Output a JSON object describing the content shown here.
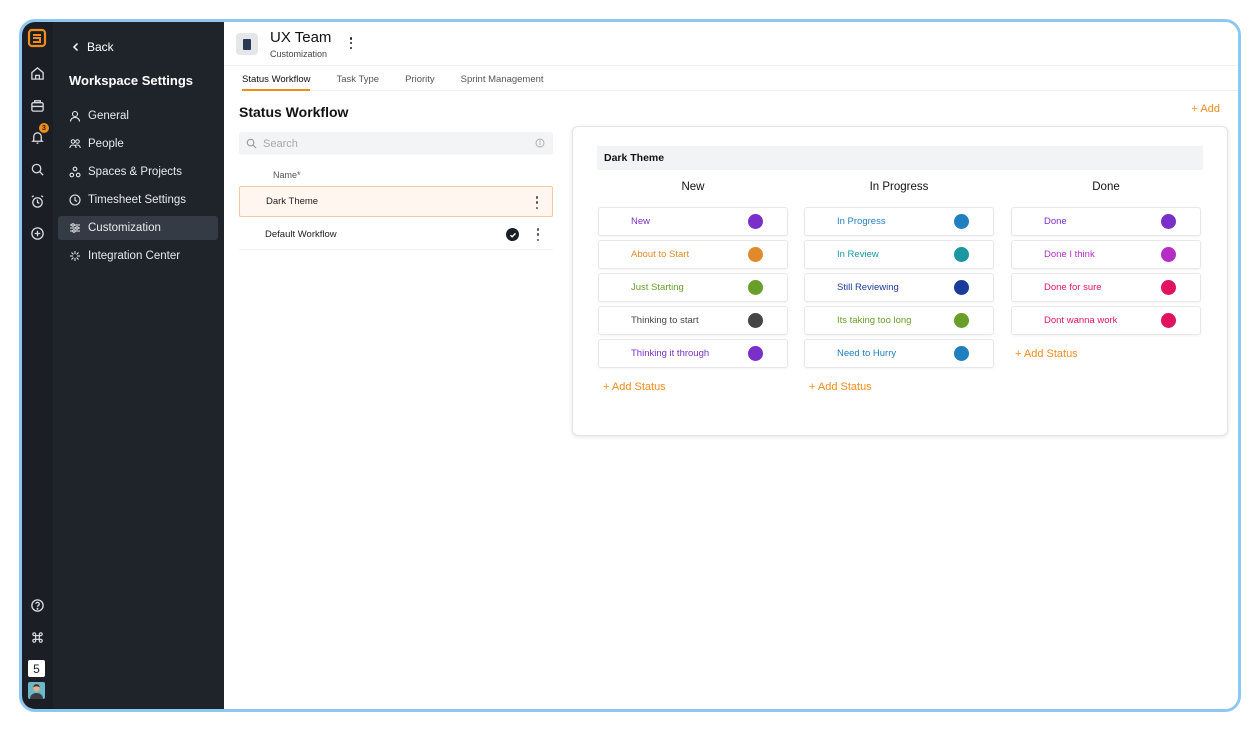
{
  "rail": {
    "notification_count": "3",
    "workspace_number": "5"
  },
  "sidebar": {
    "back_label": "Back",
    "title": "Workspace Settings",
    "items": [
      {
        "label": "General",
        "icon": "user-icon"
      },
      {
        "label": "People",
        "icon": "people-icon"
      },
      {
        "label": "Spaces & Projects",
        "icon": "spaces-icon"
      },
      {
        "label": "Timesheet Settings",
        "icon": "clock-icon"
      },
      {
        "label": "Customization",
        "icon": "sliders-icon",
        "active": true
      },
      {
        "label": "Integration Center",
        "icon": "integration-icon"
      }
    ]
  },
  "header": {
    "team_name": "UX Team",
    "subtitle": "Customization"
  },
  "tabs": [
    "Status Workflow",
    "Task Type",
    "Priority",
    "Sprint Management"
  ],
  "section": {
    "title": "Status Workflow",
    "add_label": "+ Add"
  },
  "search": {
    "placeholder": "Search"
  },
  "workflow_list": {
    "column_header": "Name*",
    "rows": [
      "Dark Theme",
      "Default Workflow"
    ]
  },
  "panel": {
    "title": "Dark Theme",
    "add_status_label": "+ Add Status",
    "columns": [
      {
        "title": "New",
        "statuses": [
          {
            "label": "New",
            "color": "#7b2fc9"
          },
          {
            "label": "About to Start",
            "color": "#e08a2c"
          },
          {
            "label": "Just Starting",
            "color": "#6a9e2a"
          },
          {
            "label": "Thinking to start",
            "color": "#454545"
          },
          {
            "label": "Thinking it through",
            "color": "#7b2fc9"
          }
        ]
      },
      {
        "title": "In Progress",
        "statuses": [
          {
            "label": "In Progress",
            "color": "#1f7fbf"
          },
          {
            "label": "In Review",
            "color": "#1a979f"
          },
          {
            "label": "Still Reviewing",
            "color": "#1a3c9a"
          },
          {
            "label": "Its taking too long",
            "color": "#6a9e2a"
          },
          {
            "label": "Need to Hurry",
            "color": "#1f7fbf"
          }
        ]
      },
      {
        "title": "Done",
        "statuses": [
          {
            "label": "Done",
            "color": "#7b2fc9"
          },
          {
            "label": "Done I think",
            "color": "#b52cc6"
          },
          {
            "label": "Done for sure",
            "color": "#e0135f"
          },
          {
            "label": "Dont wanna work",
            "color": "#e0135f"
          }
        ]
      }
    ]
  },
  "colors": {
    "accent": "#f08c1a",
    "sidebar_bg": "#1f242b",
    "rail_bg": "#1b1f25",
    "frame_border": "#8cc8f3"
  }
}
